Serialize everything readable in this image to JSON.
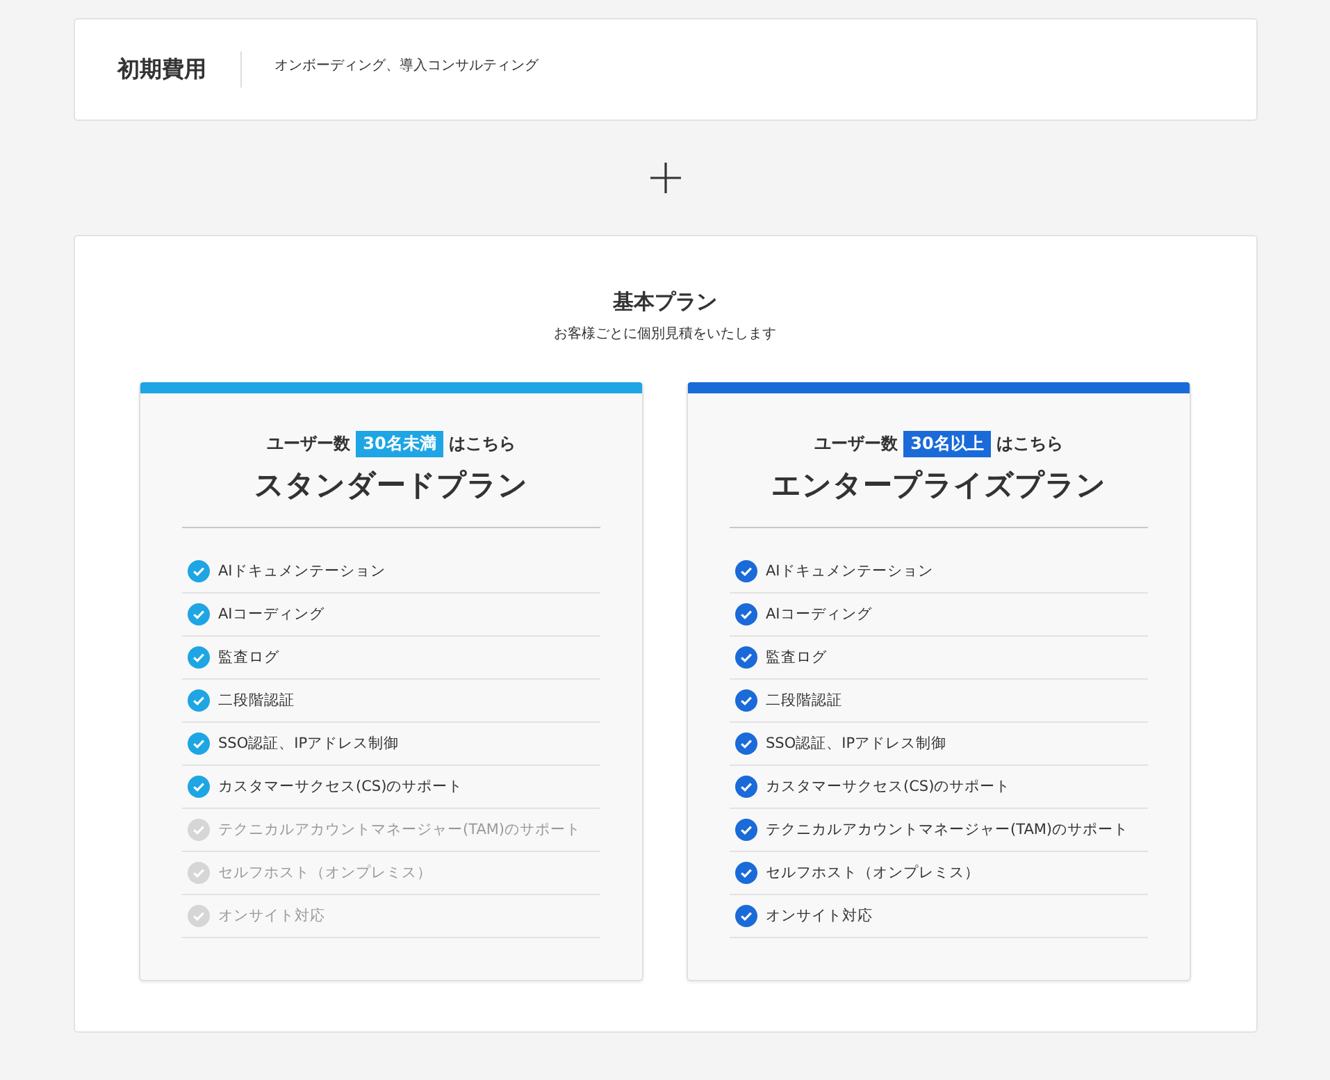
{
  "initial_cost": {
    "title": "初期費用",
    "description": "オンボーディング、導入コンサルティング"
  },
  "basic_plan": {
    "title": "基本プラン",
    "subtitle": "お客様ごとに個別見積をいたします",
    "plans": [
      {
        "color": "#1ea5e4",
        "prefix": "ユーザー数",
        "badge": "30名未満",
        "suffix": "はこちら",
        "name": "スタンダードプラン",
        "features": [
          {
            "label": "AIドキュメンテーション",
            "included": true
          },
          {
            "label": "AIコーディング",
            "included": true
          },
          {
            "label": "監査ログ",
            "included": true
          },
          {
            "label": "二段階認証",
            "included": true
          },
          {
            "label": "SSO認証、IPアドレス制御",
            "included": true
          },
          {
            "label": "カスタマーサクセス(CS)のサポート",
            "included": true
          },
          {
            "label": "テクニカルアカウントマネージャー(TAM)のサポート",
            "included": false
          },
          {
            "label": "セルフホスト（オンプレミス）",
            "included": false
          },
          {
            "label": "オンサイト対応",
            "included": false
          }
        ]
      },
      {
        "color": "#1a6ad9",
        "prefix": "ユーザー数",
        "badge": "30名以上",
        "suffix": "はこちら",
        "name": "エンタープライズプラン",
        "features": [
          {
            "label": "AIドキュメンテーション",
            "included": true
          },
          {
            "label": "AIコーディング",
            "included": true
          },
          {
            "label": "監査ログ",
            "included": true
          },
          {
            "label": "二段階認証",
            "included": true
          },
          {
            "label": "SSO認証、IPアドレス制御",
            "included": true
          },
          {
            "label": "カスタマーサクセス(CS)のサポート",
            "included": true
          },
          {
            "label": "テクニカルアカウントマネージャー(TAM)のサポート",
            "included": true
          },
          {
            "label": "セルフホスト（オンプレミス）",
            "included": true
          },
          {
            "label": "オンサイト対応",
            "included": true
          }
        ]
      }
    ]
  }
}
